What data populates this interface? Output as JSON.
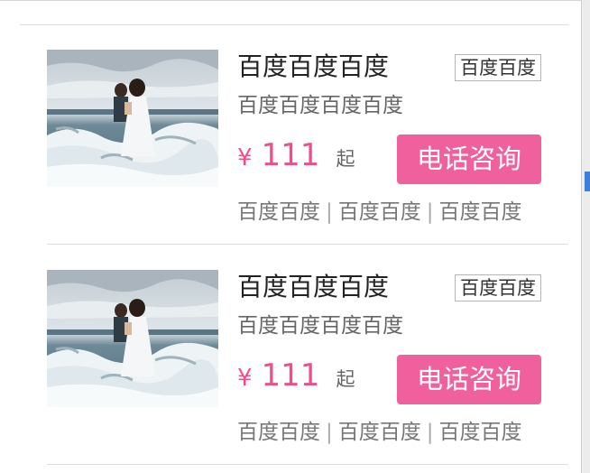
{
  "listing": {
    "items": [
      {
        "title": "百度百度百度",
        "tag": "百度百度",
        "subtitle": "百度百度百度百度",
        "currency": "¥",
        "price": "111",
        "price_suffix": "起",
        "button_label": "电话咨询",
        "features": [
          "百度百度",
          "百度百度",
          "百度百度"
        ],
        "separator": "|"
      },
      {
        "title": "百度百度百度",
        "tag": "百度百度",
        "subtitle": "百度百度百度百度",
        "currency": "¥",
        "price": "111",
        "price_suffix": "起",
        "button_label": "电话咨询",
        "features": [
          "百度百度",
          "百度百度",
          "百度百度"
        ],
        "separator": "|"
      }
    ]
  },
  "colors": {
    "accent_pink": "#ee4f8c",
    "button_bg": "#f0609d",
    "scroll_marker": "#3f7fd8"
  },
  "icons": {
    "thumbnail": "wedding-photo-image"
  }
}
